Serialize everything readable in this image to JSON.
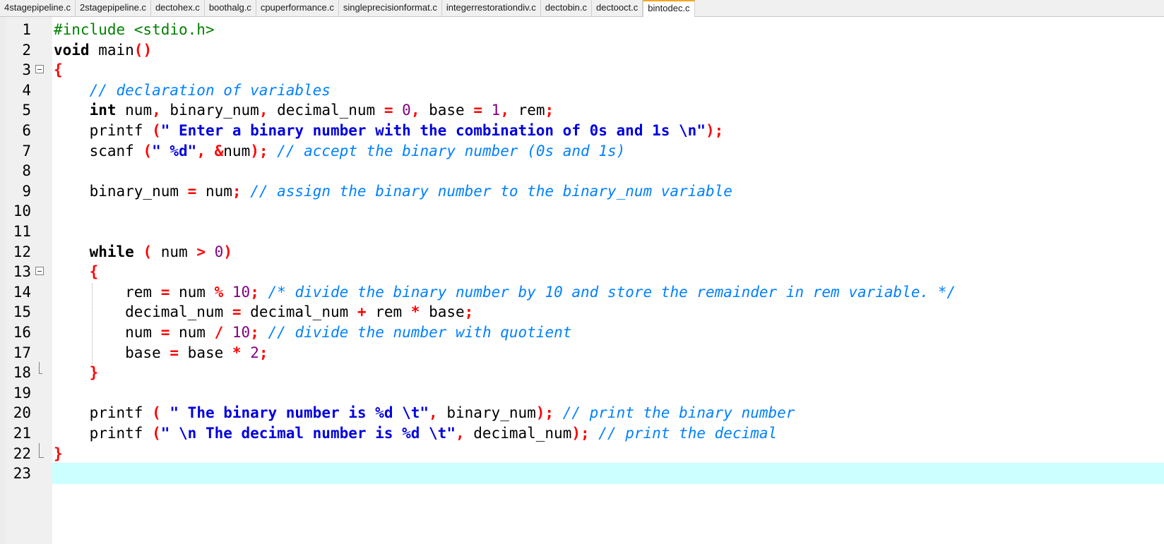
{
  "tabs": [
    {
      "label": "4stagepipeline.c",
      "active": false
    },
    {
      "label": "2stagepipeline.c",
      "active": false
    },
    {
      "label": "dectohex.c",
      "active": false
    },
    {
      "label": "boothalg.c",
      "active": false
    },
    {
      "label": "cpuperformance.c",
      "active": false
    },
    {
      "label": "singleprecisionformat.c",
      "active": false
    },
    {
      "label": "integerrestorationdiv.c",
      "active": false
    },
    {
      "label": "dectobin.c",
      "active": false
    },
    {
      "label": "dectooct.c",
      "active": false
    },
    {
      "label": "bintodec.c",
      "active": true
    }
  ],
  "colors": {
    "keyword": "#000000",
    "preprocessor": "#008000",
    "operator": "#ff0000",
    "number": "#800080",
    "string": "#0000e0",
    "comment": "#0080ff",
    "current_line": "#ccffff",
    "active_tab_accent": "#f5a623"
  },
  "editor": {
    "current_line": 23,
    "lines": [
      {
        "n": "1",
        "fold": "",
        "tokens": [
          [
            "pp",
            "#include <stdio.h>"
          ]
        ]
      },
      {
        "n": "2",
        "fold": "",
        "tokens": [
          [
            "kw",
            "void"
          ],
          [
            "id",
            " main"
          ],
          [
            "op",
            "()"
          ]
        ]
      },
      {
        "n": "3",
        "fold": "box",
        "tokens": [
          [
            "op",
            "{"
          ]
        ]
      },
      {
        "n": "4",
        "fold": "",
        "tokens": [
          [
            "id",
            "    "
          ],
          [
            "cm",
            "// declaration of variables"
          ]
        ]
      },
      {
        "n": "5",
        "fold": "",
        "tokens": [
          [
            "id",
            "    "
          ],
          [
            "kw",
            "int"
          ],
          [
            "id",
            " num"
          ],
          [
            "op",
            ","
          ],
          [
            "id",
            " binary_num"
          ],
          [
            "op",
            ","
          ],
          [
            "id",
            " decimal_num "
          ],
          [
            "op",
            "="
          ],
          [
            "id",
            " "
          ],
          [
            "nm",
            "0"
          ],
          [
            "op",
            ","
          ],
          [
            "id",
            " base "
          ],
          [
            "op",
            "="
          ],
          [
            "id",
            " "
          ],
          [
            "nm",
            "1"
          ],
          [
            "op",
            ","
          ],
          [
            "id",
            " rem"
          ],
          [
            "op",
            ";"
          ]
        ]
      },
      {
        "n": "6",
        "fold": "",
        "tokens": [
          [
            "id",
            "    printf "
          ],
          [
            "op",
            "("
          ],
          [
            "str",
            "\" Enter a binary number with the combination of 0s and 1s \\n\""
          ],
          [
            "op",
            ");"
          ]
        ]
      },
      {
        "n": "7",
        "fold": "",
        "tokens": [
          [
            "id",
            "    scanf "
          ],
          [
            "op",
            "("
          ],
          [
            "str",
            "\" %d\""
          ],
          [
            "op",
            ","
          ],
          [
            "id",
            " "
          ],
          [
            "op",
            "&"
          ],
          [
            "id",
            "num"
          ],
          [
            "op",
            ");"
          ],
          [
            "id",
            " "
          ],
          [
            "cm",
            "// accept the binary number (0s and 1s)"
          ]
        ]
      },
      {
        "n": "8",
        "fold": "",
        "tokens": []
      },
      {
        "n": "9",
        "fold": "",
        "tokens": [
          [
            "id",
            "    binary_num "
          ],
          [
            "op",
            "="
          ],
          [
            "id",
            " num"
          ],
          [
            "op",
            ";"
          ],
          [
            "id",
            " "
          ],
          [
            "cm",
            "// assign the binary number to the binary_num variable"
          ]
        ]
      },
      {
        "n": "10",
        "fold": "",
        "tokens": []
      },
      {
        "n": "11",
        "fold": "",
        "tokens": []
      },
      {
        "n": "12",
        "fold": "",
        "tokens": [
          [
            "id",
            "    "
          ],
          [
            "kw",
            "while"
          ],
          [
            "id",
            " "
          ],
          [
            "op",
            "("
          ],
          [
            "id",
            " num "
          ],
          [
            "op",
            ">"
          ],
          [
            "id",
            " "
          ],
          [
            "nm",
            "0"
          ],
          [
            "op",
            ")"
          ]
        ]
      },
      {
        "n": "13",
        "fold": "box",
        "tokens": [
          [
            "id",
            "    "
          ],
          [
            "op",
            "{"
          ]
        ]
      },
      {
        "n": "14",
        "fold": "",
        "tokens": [
          [
            "id",
            "        rem "
          ],
          [
            "op",
            "="
          ],
          [
            "id",
            " num "
          ],
          [
            "op",
            "%"
          ],
          [
            "id",
            " "
          ],
          [
            "nm",
            "10"
          ],
          [
            "op",
            ";"
          ],
          [
            "id",
            " "
          ],
          [
            "cm",
            "/* divide the binary number by 10 and store the remainder in rem variable. */"
          ]
        ]
      },
      {
        "n": "15",
        "fold": "",
        "tokens": [
          [
            "id",
            "        decimal_num "
          ],
          [
            "op",
            "="
          ],
          [
            "id",
            " decimal_num "
          ],
          [
            "op",
            "+"
          ],
          [
            "id",
            " rem "
          ],
          [
            "op",
            "*"
          ],
          [
            "id",
            " base"
          ],
          [
            "op",
            ";"
          ]
        ]
      },
      {
        "n": "16",
        "fold": "",
        "tokens": [
          [
            "id",
            "        num "
          ],
          [
            "op",
            "="
          ],
          [
            "id",
            " num "
          ],
          [
            "op",
            "/"
          ],
          [
            "id",
            " "
          ],
          [
            "nm",
            "10"
          ],
          [
            "op",
            ";"
          ],
          [
            "id",
            " "
          ],
          [
            "cm",
            "// divide the number with quotient"
          ]
        ]
      },
      {
        "n": "17",
        "fold": "",
        "tokens": [
          [
            "id",
            "        base "
          ],
          [
            "op",
            "="
          ],
          [
            "id",
            " base "
          ],
          [
            "op",
            "*"
          ],
          [
            "id",
            " "
          ],
          [
            "nm",
            "2"
          ],
          [
            "op",
            ";"
          ]
        ]
      },
      {
        "n": "18",
        "fold": "tick",
        "tokens": [
          [
            "id",
            "    "
          ],
          [
            "op",
            "}"
          ]
        ]
      },
      {
        "n": "19",
        "fold": "",
        "tokens": []
      },
      {
        "n": "20",
        "fold": "",
        "tokens": [
          [
            "id",
            "    printf "
          ],
          [
            "op",
            "("
          ],
          [
            "id",
            " "
          ],
          [
            "str",
            "\" The binary number is %d \\t\""
          ],
          [
            "op",
            ","
          ],
          [
            "id",
            " binary_num"
          ],
          [
            "op",
            ");"
          ],
          [
            "id",
            " "
          ],
          [
            "cm",
            "// print the binary number"
          ]
        ]
      },
      {
        "n": "21",
        "fold": "",
        "tokens": [
          [
            "id",
            "    printf "
          ],
          [
            "op",
            "("
          ],
          [
            "str",
            "\" \\n The decimal number is %d \\t\""
          ],
          [
            "op",
            ","
          ],
          [
            "id",
            " decimal_num"
          ],
          [
            "op",
            ");"
          ],
          [
            "id",
            " "
          ],
          [
            "cm",
            "// print the decimal"
          ]
        ]
      },
      {
        "n": "22",
        "fold": "end",
        "tokens": [
          [
            "op",
            "}"
          ]
        ]
      },
      {
        "n": "23",
        "fold": "",
        "tokens": []
      }
    ]
  }
}
